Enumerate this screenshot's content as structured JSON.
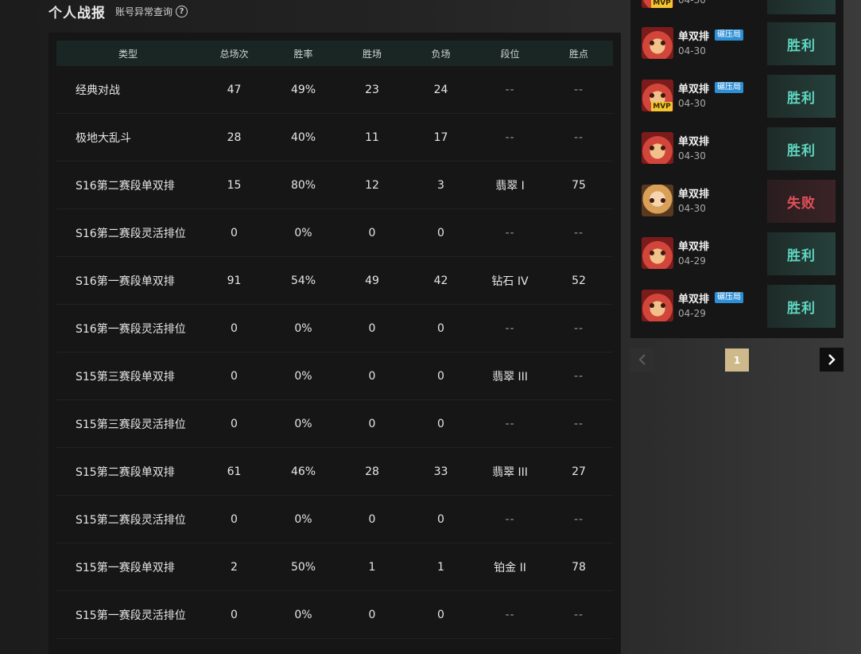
{
  "header": {
    "title": "个人战报",
    "link": "账号异常查询",
    "help_glyph": "?"
  },
  "stats_table": {
    "columns": [
      "类型",
      "总场次",
      "胜率",
      "胜场",
      "负场",
      "段位",
      "胜点"
    ],
    "rows": [
      [
        "经典对战",
        "47",
        "49%",
        "23",
        "24",
        "--",
        "--"
      ],
      [
        "极地大乱斗",
        "28",
        "40%",
        "11",
        "17",
        "--",
        "--"
      ],
      [
        "S16第二赛段单双排",
        "15",
        "80%",
        "12",
        "3",
        "翡翠 I",
        "75"
      ],
      [
        "S16第二赛段灵活排位",
        "0",
        "0%",
        "0",
        "0",
        "--",
        "--"
      ],
      [
        "S16第一赛段单双排",
        "91",
        "54%",
        "49",
        "42",
        "钻石 IV",
        "52"
      ],
      [
        "S16第一赛段灵活排位",
        "0",
        "0%",
        "0",
        "0",
        "--",
        "--"
      ],
      [
        "S15第三赛段单双排",
        "0",
        "0%",
        "0",
        "0",
        "翡翠 III",
        "--"
      ],
      [
        "S15第三赛段灵活排位",
        "0",
        "0%",
        "0",
        "0",
        "--",
        "--"
      ],
      [
        "S15第二赛段单双排",
        "61",
        "46%",
        "28",
        "33",
        "翡翠 III",
        "27"
      ],
      [
        "S15第二赛段灵活排位",
        "0",
        "0%",
        "0",
        "0",
        "--",
        "--"
      ],
      [
        "S15第一赛段单双排",
        "2",
        "50%",
        "1",
        "1",
        "铂金 II",
        "78"
      ],
      [
        "S15第一赛段灵活排位",
        "0",
        "0%",
        "0",
        "0",
        "--",
        "--"
      ]
    ]
  },
  "matches": {
    "partial_top": {
      "badge": "MVP",
      "date": "04-30"
    },
    "items": [
      {
        "avatar": "fox",
        "mode": "单双排",
        "tag": "碾压局",
        "mvp": "",
        "date": "04-30",
        "result": "胜利",
        "outcome": "win"
      },
      {
        "avatar": "fox",
        "mode": "单双排",
        "tag": "碾压局",
        "mvp": "MVP",
        "date": "04-30",
        "result": "胜利",
        "outcome": "win"
      },
      {
        "avatar": "fox",
        "mode": "单双排",
        "tag": "",
        "mvp": "",
        "date": "04-30",
        "result": "胜利",
        "outcome": "win"
      },
      {
        "avatar": "lady",
        "mode": "单双排",
        "tag": "",
        "mvp": "",
        "date": "04-30",
        "result": "失败",
        "outcome": "loss"
      },
      {
        "avatar": "fox",
        "mode": "单双排",
        "tag": "",
        "mvp": "",
        "date": "04-29",
        "result": "胜利",
        "outcome": "win"
      },
      {
        "avatar": "fox",
        "mode": "单双排",
        "tag": "碾压局",
        "mvp": "",
        "date": "04-29",
        "result": "胜利",
        "outcome": "win"
      }
    ]
  },
  "pagination": {
    "current_page": "1",
    "prev_icon": "chevron-left-icon",
    "next_icon": "chevron-right-icon"
  },
  "colors": {
    "win": "#5fd6c0",
    "loss": "#e3505a",
    "tag": "#2e8fd6",
    "mvp": "#f2c531",
    "page_active": "#cdb98a"
  }
}
